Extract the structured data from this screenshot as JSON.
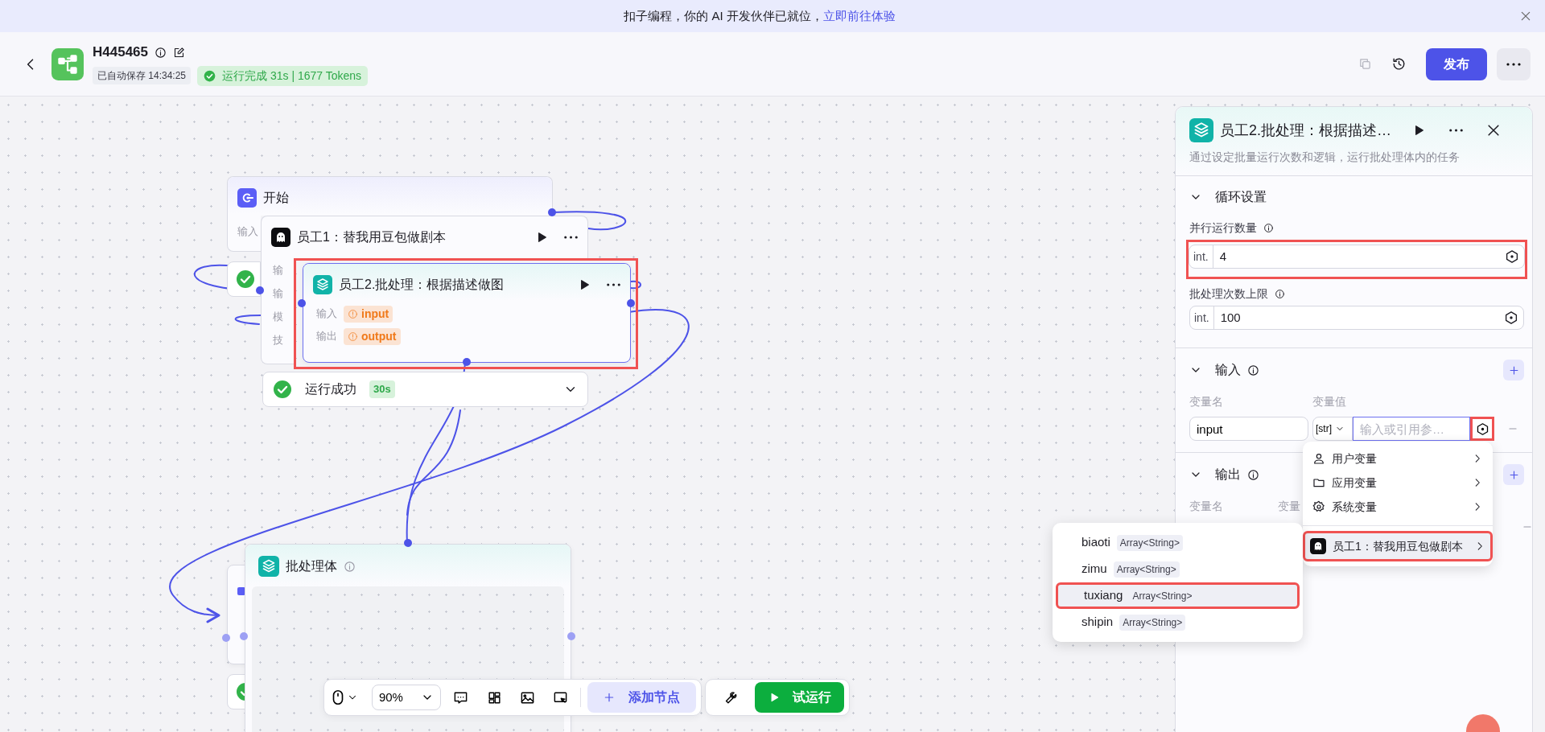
{
  "banner": {
    "text": "扣子编程，你的 AI 开发伙伴已就位，",
    "link": "立即前往体验"
  },
  "header": {
    "title": "H445465",
    "autosave": "已自动保存 14:34:25",
    "run_status": "运行完成 31s | 1677 Tokens",
    "run_success": true,
    "publish": "发布"
  },
  "nodes": [
    {
      "kind": "start",
      "title": "开始",
      "selected": false,
      "rows": [
        {
          "label": "输入"
        }
      ],
      "status": {
        "success": true
      }
    },
    {
      "kind": "agent",
      "title": "员工1：替我用豆包做剧本",
      "selected": false,
      "rows": [
        {
          "label": "输"
        },
        {
          "label": "输"
        },
        {
          "label": "模"
        },
        {
          "label": "技"
        }
      ],
      "status": {
        "success": true,
        "text": "运行成功",
        "duration": "30s"
      }
    },
    {
      "kind": "batch",
      "title": "员工2.批处理：根据描述做图",
      "selected": true,
      "highlighted": true,
      "rows": [
        {
          "label": "输入",
          "tag": "input"
        },
        {
          "label": "输出",
          "tag": "output"
        }
      ]
    },
    {
      "kind": "covered",
      "selected": false,
      "status": {
        "success": true
      }
    },
    {
      "kind": "batch_body",
      "title": "批处理体",
      "selected": false
    }
  ],
  "toolbar": {
    "zoom": "90%",
    "add_node": "添加节点",
    "test_run": "试运行"
  },
  "panel": {
    "title": "员工2.批处理：根据描述…",
    "description": "通过设定批量运行次数和逻辑，运行批处理体内的任务",
    "sections": [
      {
        "kind": "settings",
        "title": "循环设置",
        "expanded": true,
        "fields": [
          {
            "label": "并行运行数量",
            "type": "int.",
            "value": "4",
            "highlighted": true
          },
          {
            "label": "批处理次数上限",
            "type": "int.",
            "value": "100",
            "highlighted": false
          }
        ]
      },
      {
        "kind": "input",
        "title": "输入",
        "expanded": true,
        "columns": [
          "变量名",
          "变量值"
        ],
        "rows": [
          {
            "name": "input",
            "type": "[str]",
            "placeholder": "输入或引用参…",
            "ref_highlighted": true
          }
        ]
      },
      {
        "kind": "output",
        "title": "输出",
        "expanded": true,
        "columns": [
          "变量名",
          "变量"
        ]
      }
    ]
  },
  "menu": {
    "items": [
      {
        "kind": "user",
        "label": "用户变量",
        "selected": false,
        "highlighted": false
      },
      {
        "kind": "folder",
        "label": "应用变量",
        "selected": false,
        "highlighted": false
      },
      {
        "kind": "system",
        "label": "系统变量",
        "selected": false,
        "highlighted": false
      },
      {
        "kind": "node",
        "label": "员工1：替我用豆包做剧本",
        "selected": true,
        "highlighted": true
      }
    ]
  },
  "submenu": {
    "items": [
      {
        "name": "biaoti",
        "type": "Array<String>",
        "selected": false,
        "highlighted": false
      },
      {
        "name": "zimu",
        "type": "Array<String>",
        "selected": false,
        "highlighted": false
      },
      {
        "name": "tuxiang",
        "type": "Array<String>",
        "selected": true,
        "highlighted": true
      },
      {
        "name": "shipin",
        "type": "Array<String>",
        "selected": false,
        "highlighted": false
      }
    ]
  }
}
